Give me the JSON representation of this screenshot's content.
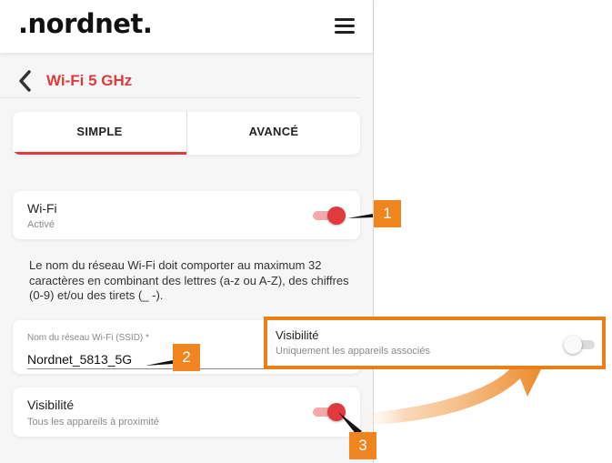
{
  "header": {
    "logo": ".nordnet.",
    "menu_icon": "hamburger-menu-icon"
  },
  "page": {
    "back_icon": "chevron-left-icon",
    "title": "Wi-Fi 5 GHz"
  },
  "tabs": [
    {
      "label": "SIMPLE",
      "active": true
    },
    {
      "label": "AVANCÉ",
      "active": false
    }
  ],
  "wifi_card": {
    "title": "Wi-Fi",
    "status": "Activé",
    "enabled": true
  },
  "help_text": "Le nom du réseau Wi-Fi doit comporter au maximum 32 caractères en combinant des lettres (a-z ou A-Z), des chiffres (0-9) et/ou des tirets (_ -).",
  "ssid_field": {
    "label": "Nom du réseau Wi-Fi (SSID) *",
    "value": "Nordnet_5813_5G"
  },
  "visibility_card": {
    "title": "Visibilité",
    "status": "Tous les appareils à proximité",
    "enabled": true
  },
  "zoom_panel": {
    "title": "Visibilité",
    "status": "Uniquement les appareils associés",
    "enabled": false
  },
  "callouts": [
    "1",
    "2",
    "3"
  ],
  "colors": {
    "accent": "#e03a3e",
    "callout": "#f0851f",
    "zoom_border": "#ea7f16"
  }
}
